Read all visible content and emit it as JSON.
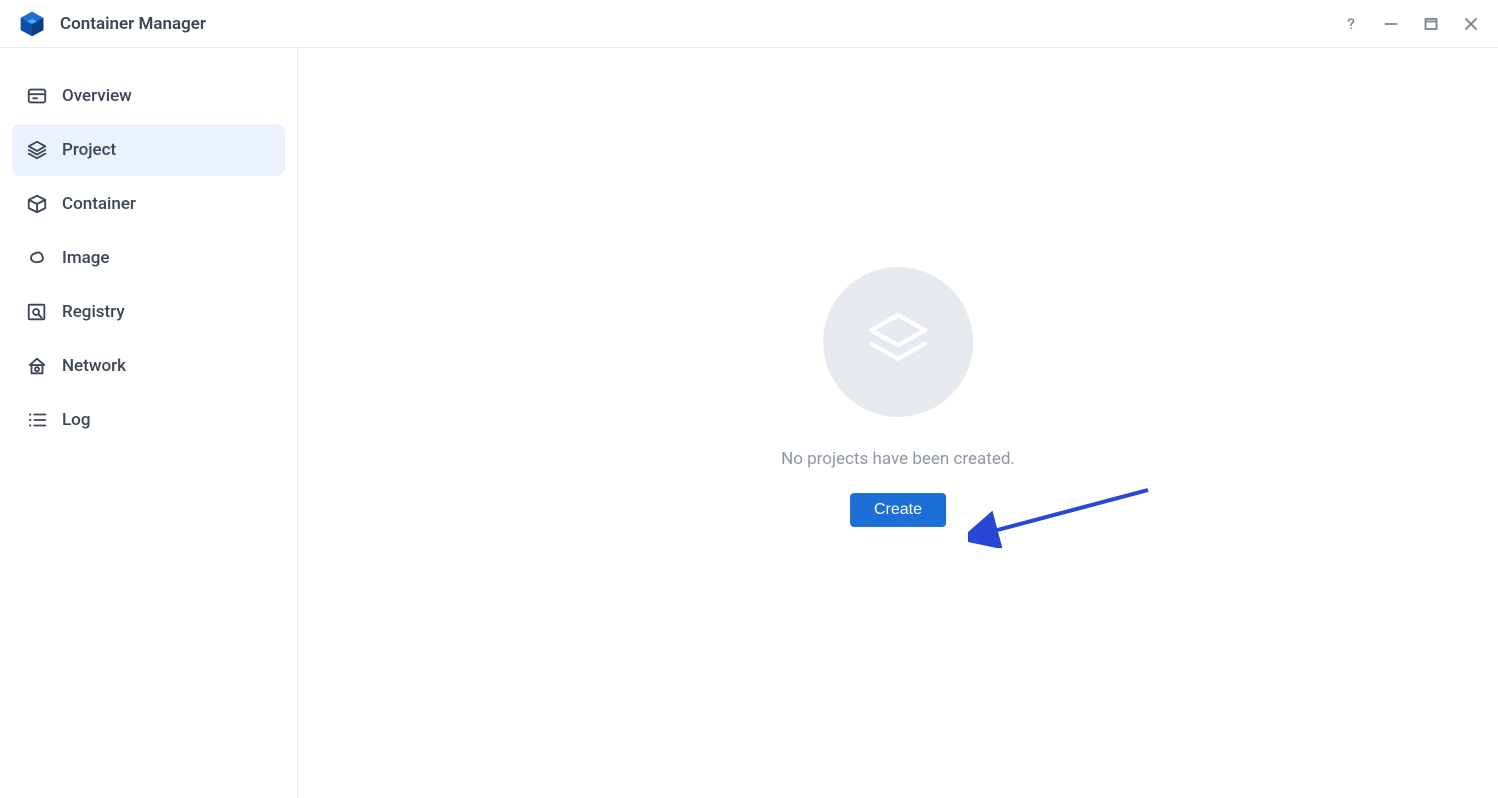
{
  "header": {
    "title": "Container Manager"
  },
  "sidebar": {
    "items": [
      {
        "label": "Overview"
      },
      {
        "label": "Project"
      },
      {
        "label": "Container"
      },
      {
        "label": "Image"
      },
      {
        "label": "Registry"
      },
      {
        "label": "Network"
      },
      {
        "label": "Log"
      }
    ],
    "active_index": 1
  },
  "main": {
    "empty_message": "No projects have been created.",
    "create_label": "Create"
  },
  "colors": {
    "accent": "#1b6fd6",
    "sidebar_active_bg": "#ebf2fd"
  }
}
